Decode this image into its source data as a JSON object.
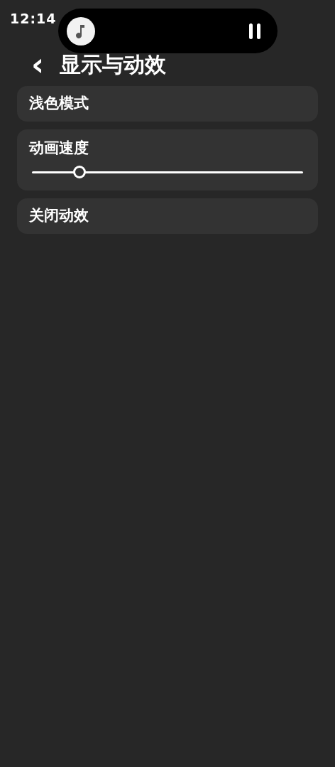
{
  "status_bar": {
    "time": "12:14"
  },
  "media_island": {
    "playing": true
  },
  "header": {
    "back": "‹",
    "title": "显示与动效"
  },
  "settings": [
    {
      "kind": "row",
      "label": "浅色模式"
    },
    {
      "kind": "slider",
      "label": "动画速度",
      "level": 0.175
    },
    {
      "kind": "row",
      "label": "关闭动效"
    }
  ]
}
